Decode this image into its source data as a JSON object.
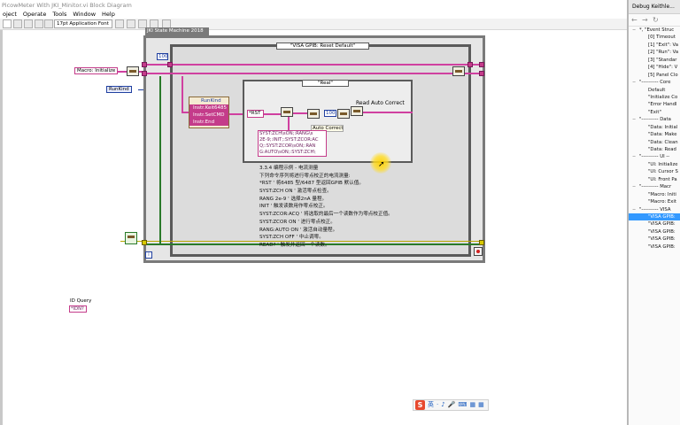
{
  "window": {
    "title": "PicowMeter With JKI_Minitor.vi Block Diagram",
    "menus": [
      "oject",
      "Operate",
      "Tools",
      "Window",
      "Help"
    ],
    "font_dropdown": "17pt Application Font"
  },
  "diagram": {
    "state_machine_title": "JKI State Machine 2018",
    "case_selector": "\"VISA GPIB: Reset Default\"",
    "inner_case_selector": "\"Real\"",
    "macro_initialize": "Macro: Initialize",
    "runkind_control": "RunKind",
    "bundle_items": [
      "RunKind",
      "Instr.Keit6485",
      "Instr.SetCMD",
      "Instr.End"
    ],
    "num_100_a": "100",
    "num_100_b": "100",
    "rst_const": "*RST",
    "cmd_lines": [
      "SYST:ZCH\\sON;:RANG\\s",
      "2E-9;:INIT;:SYST:ZCOR:AC",
      "Q;:SYST:ZCOR\\sON;:RAN",
      "G:AUTO\\sON;:SYST:ZCH\\"
    ],
    "auto_correct": "Auto Correct",
    "read_auto_correct": "Read Auto Correct",
    "comment_lines": [
      "3.3.4 编程示例 - 电流测量",
      "下列命令序列将进行零点校正的电流测量:",
      "*RST ' 将6485 型/6487 型返回GPIB 默认值。",
      "SYST:ZCH ON ' 激活零点检查。",
      "RANG 2e-9 ' 选择2nA 量程。",
      "INIT ' 触发读数用作零点校正。",
      "SYST:ZCOR:ACQ ' 将选取的最后一个读数作为零点校正值。",
      "SYST:ZCOR ON ' 进行零点校正。",
      "RANG:AUTO ON ' 激活自动量程。",
      "SYST:ZCH OFF ' 中止调零。",
      "READ? ' 触发并返回一个读数。"
    ],
    "iteration": "i",
    "id_query_label": "ID Query",
    "id_query_const": "*IDN?"
  },
  "debug_panel": {
    "title": "Debug Keithle...",
    "selected_index": 33,
    "items": [
      {
        "label": "*, \"Event Struc",
        "level": 0
      },
      {
        "label": "[0] Timeout",
        "level": 1
      },
      {
        "label": "[1] \"Exit\": Va",
        "level": 1
      },
      {
        "label": "[2] \"Run\": Va",
        "level": 1
      },
      {
        "label": "[3] \"Standar",
        "level": 1
      },
      {
        "label": "[4] \"Hide\": V",
        "level": 1
      },
      {
        "label": "[5] Panel Clo",
        "level": 1
      },
      {
        "label": "\"---------- Core",
        "level": 0
      },
      {
        "label": "Default",
        "level": 1
      },
      {
        "label": "\"Initialize Co",
        "level": 1
      },
      {
        "label": "\"Error Handl",
        "level": 1
      },
      {
        "label": "\"Exit\"",
        "level": 1
      },
      {
        "label": "\"---------- Data",
        "level": 0
      },
      {
        "label": "\"Data: Initial",
        "level": 1
      },
      {
        "label": "\"Data: Make",
        "level": 1
      },
      {
        "label": "\"Data: Clean",
        "level": 1
      },
      {
        "label": "\"Data: Read",
        "level": 1
      },
      {
        "label": "\"---------- UI --",
        "level": 0
      },
      {
        "label": "\"UI: Initialize",
        "level": 1
      },
      {
        "label": "\"UI: Cursor S",
        "level": 1
      },
      {
        "label": "\"UI: Front Pa",
        "level": 1
      },
      {
        "label": "\"---------- Macr",
        "level": 0
      },
      {
        "label": "\"Macro: Initi",
        "level": 1
      },
      {
        "label": "\"Macro: Exit",
        "level": 1
      },
      {
        "label": "\"---------- VISA",
        "level": 0
      },
      {
        "label": "\"VISA GPIB:",
        "level": 1
      },
      {
        "label": "\"VISA GPIB:",
        "level": 1
      },
      {
        "label": "\"VISA GPIB:",
        "level": 1
      },
      {
        "label": "\"VISA GPIB:",
        "level": 1
      },
      {
        "label": "\"VISA GPIB:",
        "level": 1
      }
    ]
  },
  "ime": {
    "logo": "S",
    "glyphs": [
      "英",
      "·",
      "♪",
      "🎤",
      "⌨",
      "▦",
      "▦"
    ]
  }
}
